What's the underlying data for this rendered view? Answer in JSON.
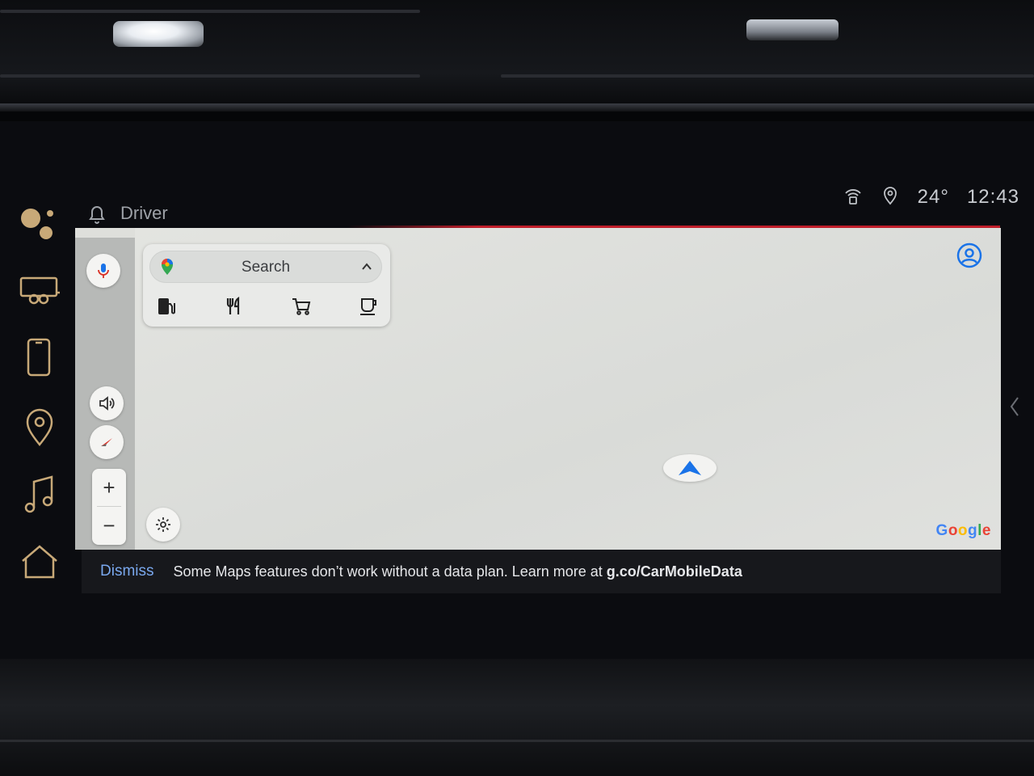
{
  "status_bar": {
    "temperature": "24°",
    "time": "12:43"
  },
  "header": {
    "profile_label": "Driver"
  },
  "search": {
    "placeholder": "Search"
  },
  "categories": [
    "gas-station",
    "restaurants",
    "grocery",
    "coffee"
  ],
  "map": {
    "attribution": "Google"
  },
  "banner": {
    "dismiss_label": "Dismiss",
    "message": "Some Maps features don’t work without a data plan. Learn more at ",
    "link": "g.co/CarMobileData"
  },
  "colors": {
    "rail_accent": "#c8a978",
    "link_blue": "#7aa8ee",
    "nav_blue": "#1a73e8",
    "map_bg": "#dedfdb"
  }
}
